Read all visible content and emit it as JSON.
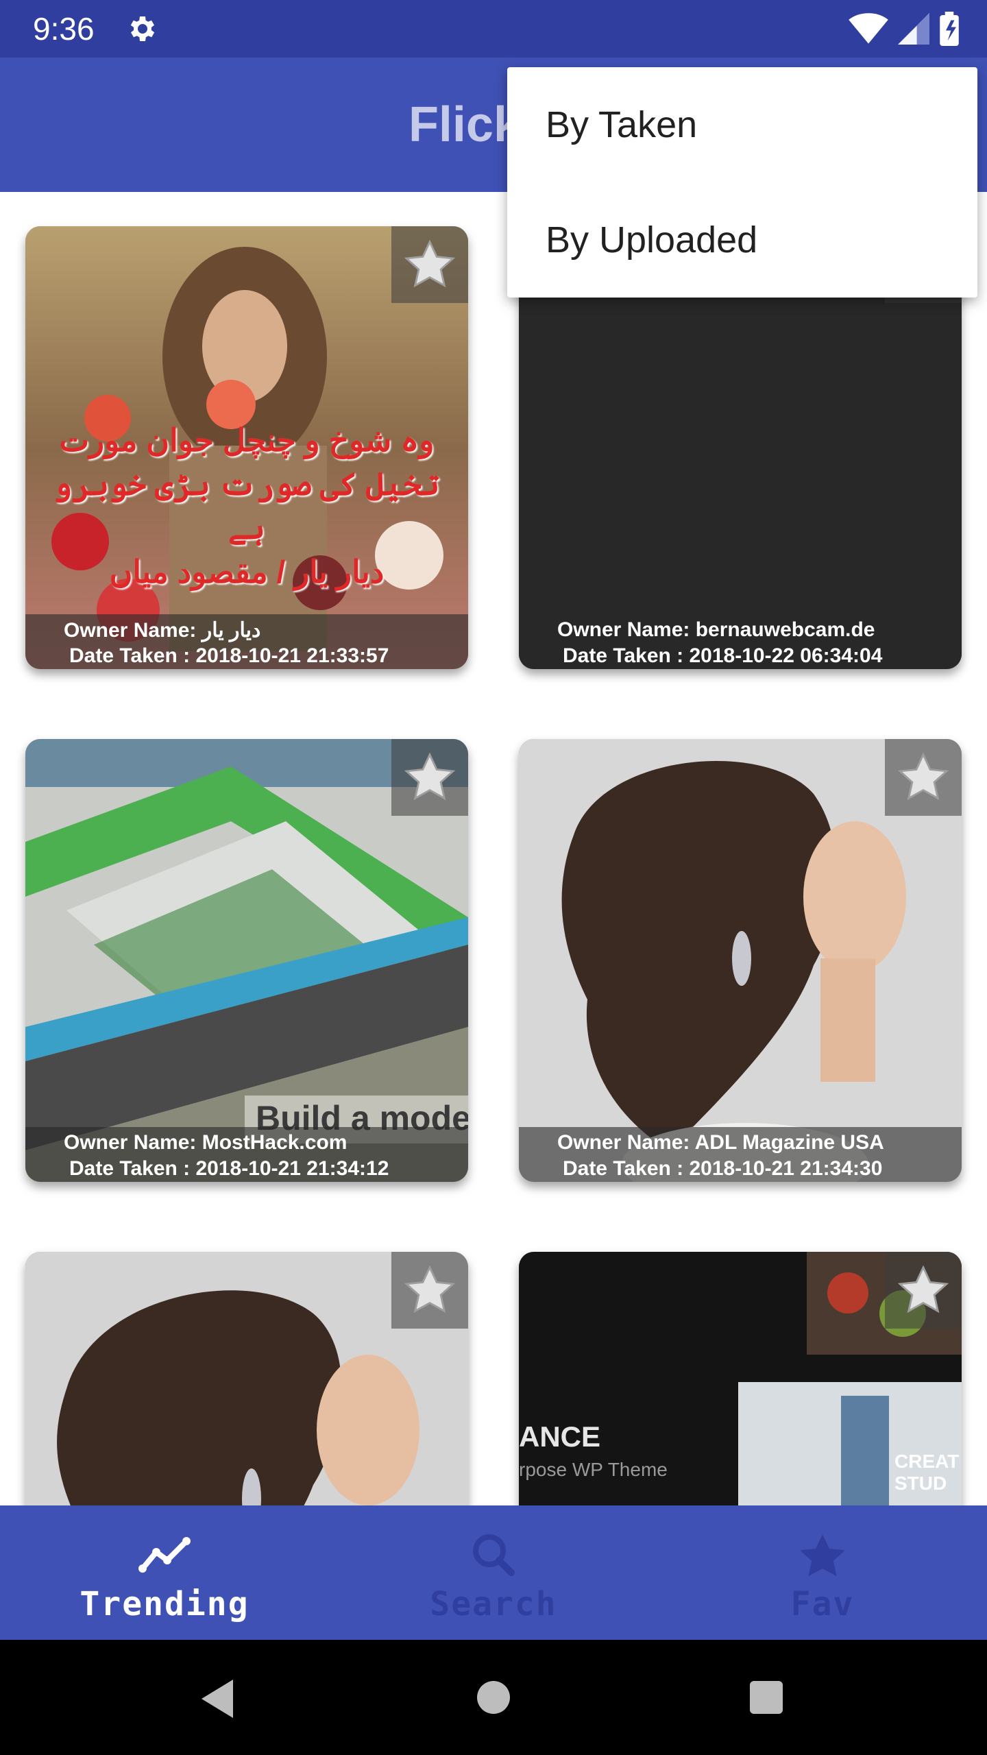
{
  "status": {
    "time": "9:36"
  },
  "appbar": {
    "title": "FlickrG"
  },
  "menu": {
    "items": [
      "By Taken",
      "By Uploaded"
    ]
  },
  "cards": [
    {
      "owner": "Owner Name: ديار يار",
      "date": "Date Taken : 2018-10-21 21:33:57",
      "overlay_text": [
        "وہ شوخ و چنچل جوان مورت",
        "تخیل کی صورت بڑی خوبرو ہے",
        "دیار یار / مقصود میاں"
      ]
    },
    {
      "owner": "Owner Name: bernauwebcam.de",
      "date": "Date Taken : 2018-10-22 06:34:04"
    },
    {
      "owner": "Owner Name: MostHack.com",
      "date": "Date Taken : 2018-10-21 21:34:12",
      "overlay_text": "Build a moder"
    },
    {
      "owner": "Owner Name: ADL Magazine USA",
      "date": "Date Taken : 2018-10-21 21:34:30"
    },
    {
      "owner": "",
      "date": ""
    },
    {
      "owner": "",
      "date": "",
      "overlay_text": [
        "ANCE",
        "rpose WP Theme",
        "CREAT",
        "STUD"
      ]
    }
  ],
  "bottom_nav": {
    "items": [
      {
        "label": "Trending",
        "icon": "trending-icon",
        "active": true
      },
      {
        "label": "Search",
        "icon": "search-icon",
        "active": false
      },
      {
        "label": "Fav",
        "icon": "star-icon",
        "active": false
      }
    ]
  },
  "colors": {
    "status_bar": "#303f9f",
    "app_bar": "#3f51b5",
    "active_nav": "#ffffff",
    "inactive_nav": "#303f9f"
  }
}
